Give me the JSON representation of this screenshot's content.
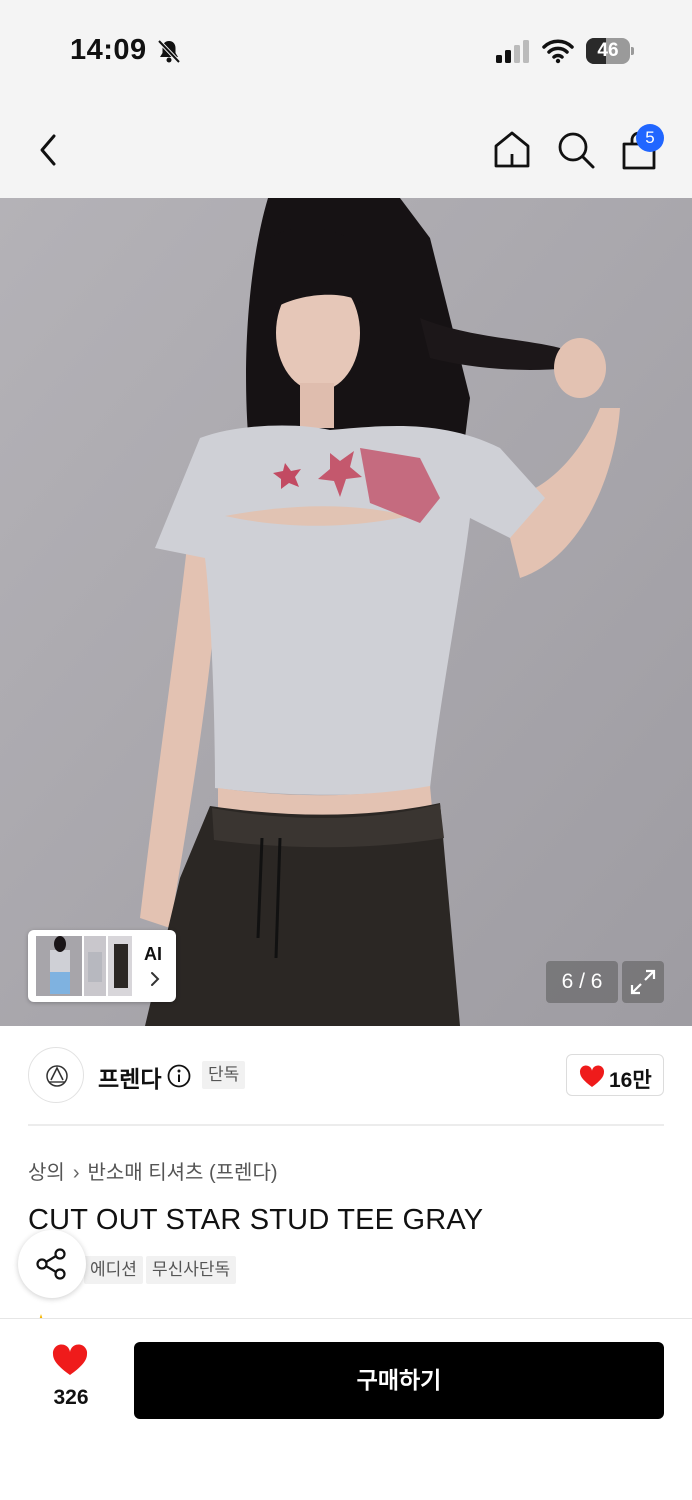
{
  "status_bar": {
    "time": "14:09",
    "battery_level": "46",
    "icons": [
      "bell-off-icon",
      "cellular-signal-icon",
      "wifi-icon",
      "battery-icon"
    ]
  },
  "nav": {
    "icons": [
      "back-chevron-icon",
      "home-icon",
      "search-icon",
      "shopping-bag-icon"
    ],
    "cart_badge": "5",
    "badge_color": "#2166ff"
  },
  "gallery": {
    "ai_label": "AI",
    "counter": "6 / 6",
    "current_image": 6,
    "total_images": 6
  },
  "brand": {
    "name": "프렌다",
    "exclusive_tag": "단독",
    "likes": "16만",
    "like_color": "#ef1b1b"
  },
  "product": {
    "breadcrumb": [
      "상의",
      "반소매 티셔츠 (프렌다)"
    ],
    "title": "CUT OUT STAR STUD TEE GRAY",
    "tags": [
      "에디션",
      "무신사단독"
    ]
  },
  "footer": {
    "like_count": "326",
    "buy_label": "구매하기"
  }
}
